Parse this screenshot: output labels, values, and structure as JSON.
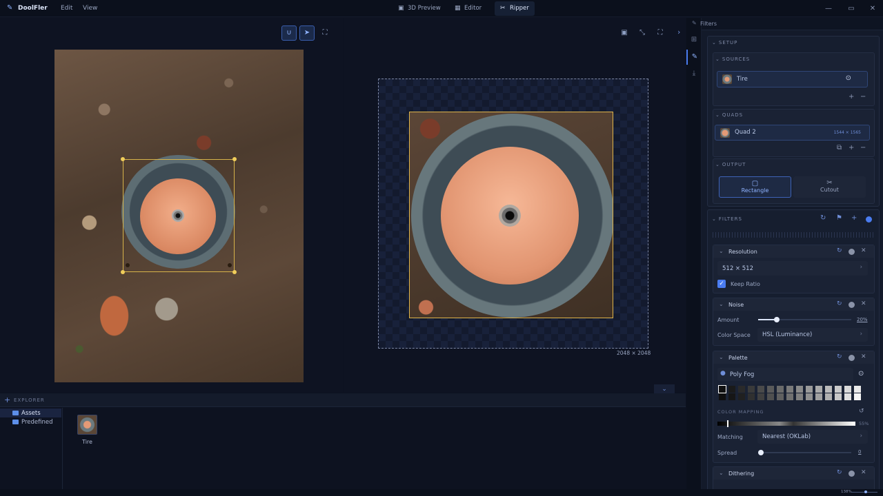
{
  "app": {
    "name": "DoolFler",
    "menu": [
      "Edit",
      "View"
    ]
  },
  "tabs": [
    {
      "label": "3D Preview",
      "icon": "cube-icon"
    },
    {
      "label": "Editor",
      "icon": "image-icon"
    },
    {
      "label": "Ripper",
      "icon": "scissors-icon",
      "active": true
    }
  ],
  "canvas": {
    "output_dims": "2048 × 2048"
  },
  "explorer": {
    "title": "EXPLORER",
    "tree": [
      "Assets",
      "Predefined"
    ],
    "assets": [
      {
        "label": "Tire"
      }
    ]
  },
  "panel": {
    "title": "Filters",
    "setup": {
      "title": "SETUP",
      "sources": {
        "title": "SOURCES",
        "items": [
          {
            "label": "Tire"
          }
        ]
      },
      "quads": {
        "title": "QUADS",
        "items": [
          {
            "label": "Quad 2",
            "dims": "1544 × 1565"
          }
        ]
      },
      "output": {
        "title": "OUTPUT",
        "modes": [
          "Rectangle",
          "Cutout"
        ],
        "selected": "Rectangle"
      }
    },
    "filters": {
      "title": "FILTERS",
      "resolution": {
        "title": "Resolution",
        "value": "512 × 512",
        "keep_ratio": "Keep Ratio",
        "keep_ratio_checked": true
      },
      "noise": {
        "title": "Noise",
        "amount_label": "Amount",
        "amount_value": "20%",
        "amount_level": 0.2,
        "color_space_label": "Color Space",
        "color_space": "HSL (Luminance)"
      },
      "palette": {
        "title": "Palette",
        "name": "Poly Fog",
        "color_mapping_label": "COLOR MAPPING",
        "mapping_value": "55%",
        "matching_label": "Matching",
        "matching": "Nearest (OKLab)",
        "spread_label": "Spread",
        "spread_value": "0",
        "spread_level": 0.0,
        "colors": [
          "#ffffff",
          "#1a1a1a",
          "#2a2a2a",
          "#3a3a3a",
          "#4a4a4a",
          "#5a5a5a",
          "#6a6a6a",
          "#7a7a7a",
          "#8a8a8a",
          "#9a9a9a",
          "#aaaaaa",
          "#bababa",
          "#cacaca",
          "#dadada",
          "#eaeaea",
          "#0f0f0f",
          "#161616",
          "#202020",
          "#303030",
          "#404040",
          "#505050",
          "#606060",
          "#707070",
          "#808080",
          "#909090",
          "#a0a0a0",
          "#b0b0b0",
          "#c8c8c8",
          "#e0e0e0",
          "#f6f6f6"
        ]
      },
      "dithering": {
        "title": "Dithering"
      }
    }
  },
  "status": {
    "zoom": "138%"
  },
  "colors": {
    "accent": "#4a7cf0",
    "quad_outline": "#d8b44a",
    "bg": "#0d1220"
  }
}
